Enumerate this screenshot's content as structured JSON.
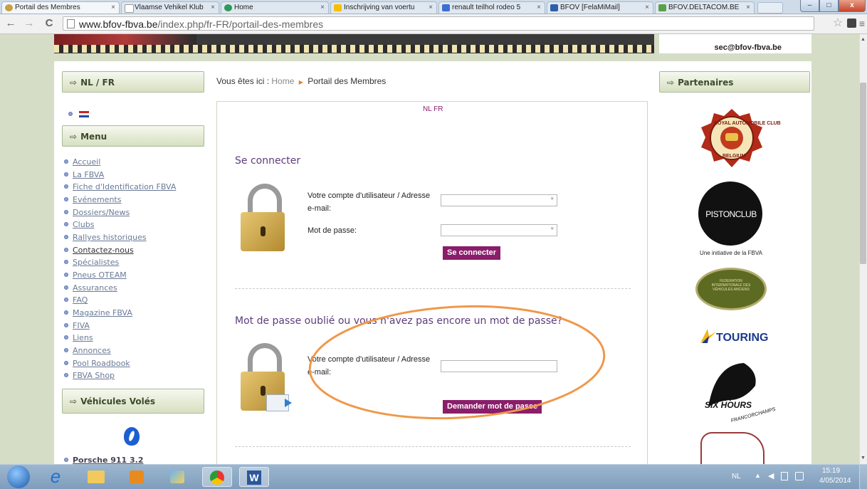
{
  "browser": {
    "tabs": [
      {
        "label": "Portail des Membres",
        "active": true,
        "icon_color": "#c8a040"
      },
      {
        "label": "Vlaamse Vehikel Klub",
        "active": false,
        "icon_color": "#ffffff"
      },
      {
        "label": "Home",
        "active": false,
        "icon_color": "#2d9a58"
      },
      {
        "label": "Inschrijving van voertu",
        "active": false,
        "icon_color": "#f5c000"
      },
      {
        "label": "renault teilhol rodeo 5",
        "active": false,
        "icon_color": "#3b6fd0"
      },
      {
        "label": "BFOV [FelaMiMail]",
        "active": false,
        "icon_color": "#2e5fa8"
      },
      {
        "label": "BFOV.DELTACOM.BE",
        "active": false,
        "icon_color": "#5aa04a"
      }
    ],
    "tab_close_glyph": "×",
    "url_host": "www.bfov-fbva.be",
    "url_path": "/index.php/fr-FR/portail-des-membres",
    "window_buttons": [
      "–",
      "□",
      "x"
    ]
  },
  "header": {
    "contact_email": "sec@bfov-fbva.be"
  },
  "left": {
    "lang_box_title": "NL / FR",
    "menu_title": "Menu",
    "menu_items": [
      "Accueil",
      "La FBVA",
      "Fiche d'Identification FBVA",
      "Evénements",
      "Dossiers/News",
      "Clubs",
      "Rallyes historiques",
      "Contactez-nous",
      "Spécialistes",
      "Pneus OTEAM",
      "Assurances",
      "FAQ",
      "Magazine FBVA",
      "FIVA",
      "Liens",
      "Annonces",
      "Pool Roadbook",
      "FBVA Shop"
    ],
    "stolen_box_title": "Véhicules Volés",
    "stolen_item": "Porsche 911 3.2"
  },
  "breadcrumb": {
    "prefix": "Vous êtes ici :",
    "home": "Home",
    "current": "Portail des Membres"
  },
  "main": {
    "lang_links": "NL FR",
    "login": {
      "title": "Se connecter",
      "user_label": "Votre compte d'utilisateur / Adresse e-mail:",
      "password_label": "Mot de passe:",
      "required_mark": "*",
      "submit": "Se connecter"
    },
    "forgot": {
      "title": "Mot de passe oublié ou vous n'avez pas encore un mot de passe?",
      "user_label": "Votre compte d'utilisateur / Adresse e-mail:",
      "submit": "Demander mot de passe"
    },
    "annotation_color": "#f0984a"
  },
  "right": {
    "partners_title": "Partenaires",
    "logos": [
      {
        "name": "royal-automobile-club-belgium",
        "text_top": "ROYAL AUTOMOBILE CLUB",
        "text_bottom": "BELGIUM"
      },
      {
        "name": "piston-club",
        "text": "PISTONCLUB",
        "caption": "Une initiative de la FBVA"
      },
      {
        "name": "fiva",
        "text": "FÉDÉRATION INTERNATIONALE DES VÉHICULES ANCIENS"
      },
      {
        "name": "touring",
        "text": "TOURING"
      },
      {
        "name": "spa-six-hours",
        "text_top": "SPA",
        "text_mid": "SIX HOURS",
        "text_bottom": "FRANCORCHAMPS"
      }
    ]
  },
  "taskbar": {
    "lang": "NL",
    "time": "15:19",
    "date": "4/05/2014"
  }
}
